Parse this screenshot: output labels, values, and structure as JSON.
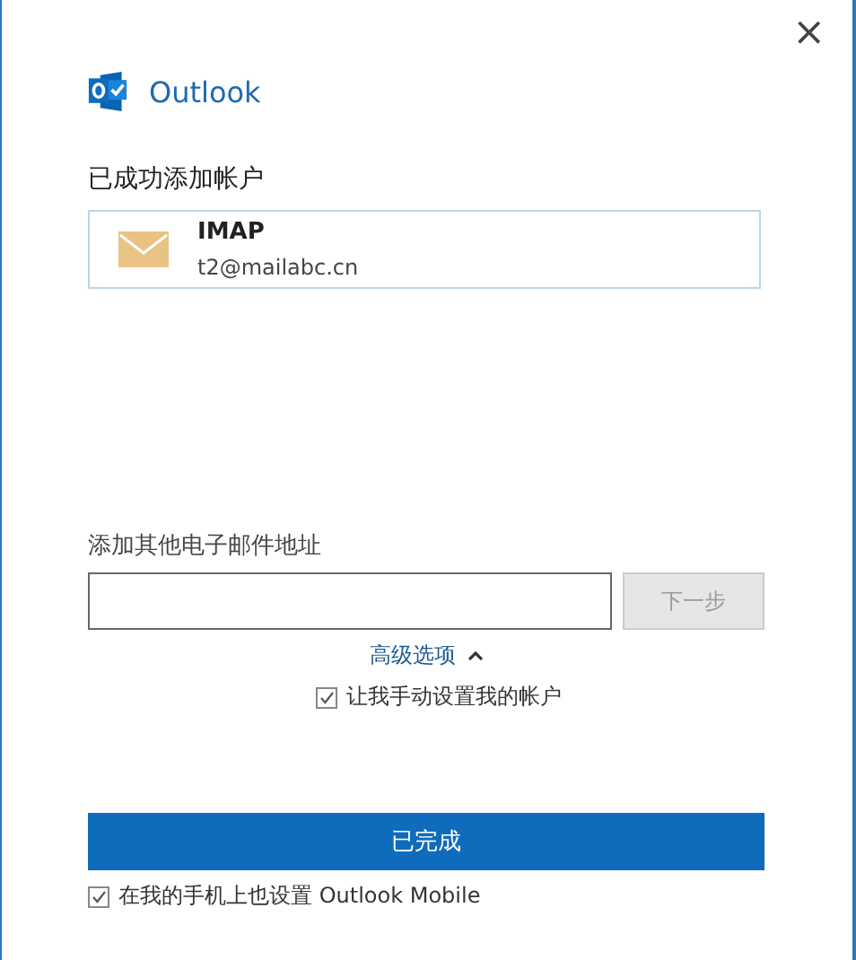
{
  "window": {
    "close": "×"
  },
  "brand": {
    "name": "Outlook"
  },
  "heading": "已成功添加帐户",
  "accounts": [
    {
      "type": "IMAP",
      "email": "t2@mailabc.cn"
    }
  ],
  "add_email": {
    "label": "添加其他电子邮件地址",
    "next_button": {
      "label": "下一步",
      "disabled": true
    }
  },
  "advanced": {
    "label": "高级选项",
    "expanded": true,
    "options": [
      {
        "label": "让我手动设置我的帐户",
        "checked": true
      }
    ]
  },
  "done_button": "已完成",
  "mobile_option": {
    "label": "在我的手机上也设置 Outlook Mobile",
    "checked": true
  }
}
